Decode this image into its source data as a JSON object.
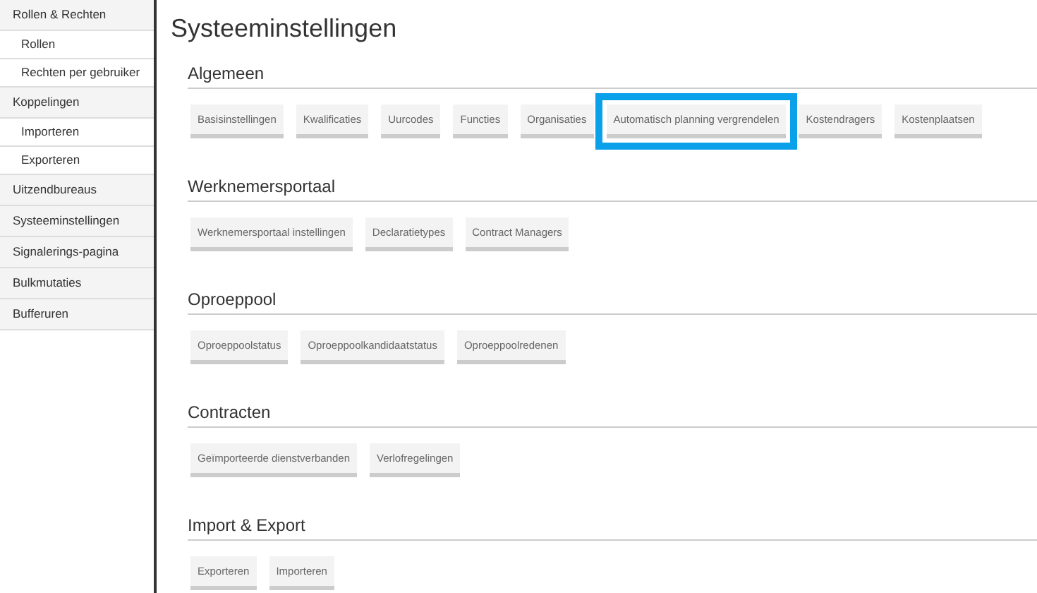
{
  "sidebar": {
    "items": [
      {
        "label": "Rollen & Rechten",
        "children": [
          {
            "label": "Rollen"
          },
          {
            "label": "Rechten per gebruiker"
          }
        ]
      },
      {
        "label": "Koppelingen",
        "children": [
          {
            "label": "Importeren"
          },
          {
            "label": "Exporteren"
          }
        ]
      },
      {
        "label": "Uitzendbureaus"
      },
      {
        "label": "Systeeminstellingen"
      },
      {
        "label": "Signalerings-pagina"
      },
      {
        "label": "Bulkmutaties"
      },
      {
        "label": "Bufferuren"
      }
    ]
  },
  "title": "Systeeminstellingen",
  "sections": [
    {
      "heading": "Algemeen",
      "buttons": [
        {
          "label": "Basisinstellingen",
          "highlighted": false
        },
        {
          "label": "Kwalificaties",
          "highlighted": false
        },
        {
          "label": "Uurcodes",
          "highlighted": false
        },
        {
          "label": "Functies",
          "highlighted": false
        },
        {
          "label": "Organisaties",
          "highlighted": false
        },
        {
          "label": "Automatisch planning vergrendelen",
          "highlighted": true
        },
        {
          "label": "Kostendragers",
          "highlighted": false
        },
        {
          "label": "Kostenplaatsen",
          "highlighted": false
        }
      ]
    },
    {
      "heading": "Werknemersportaal",
      "buttons": [
        {
          "label": "Werknemersportaal instellingen",
          "highlighted": false
        },
        {
          "label": "Declaratietypes",
          "highlighted": false
        },
        {
          "label": "Contract Managers",
          "highlighted": false
        }
      ]
    },
    {
      "heading": "Oproeppool",
      "buttons": [
        {
          "label": "Oproeppoolstatus",
          "highlighted": false
        },
        {
          "label": "Oproeppoolkandidaatstatus",
          "highlighted": false
        },
        {
          "label": "Oproeppoolredenen",
          "highlighted": false
        }
      ]
    },
    {
      "heading": "Contracten",
      "buttons": [
        {
          "label": "Geïmporteerde dienstverbanden",
          "highlighted": false
        },
        {
          "label": "Verlofregelingen",
          "highlighted": false
        }
      ]
    },
    {
      "heading": "Import & Export",
      "buttons": [
        {
          "label": "Exporteren",
          "highlighted": false
        },
        {
          "label": "Importeren",
          "highlighted": false
        }
      ]
    }
  ]
}
